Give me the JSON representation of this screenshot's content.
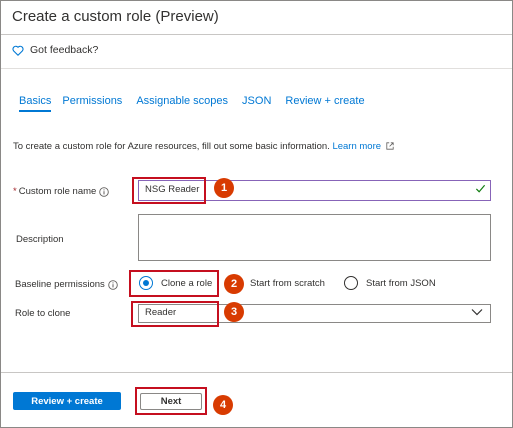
{
  "window": {
    "title": "Create a custom role (Preview)"
  },
  "feedback": {
    "label": "Got feedback?",
    "icon": "heart-icon"
  },
  "tabs": [
    {
      "label": "Basics",
      "active": true
    },
    {
      "label": "Permissions",
      "active": false
    },
    {
      "label": "Assignable scopes",
      "active": false
    },
    {
      "label": "JSON",
      "active": false
    },
    {
      "label": "Review + create",
      "active": false
    }
  ],
  "intro": {
    "text": "To create a custom role for Azure resources, fill out some basic information.",
    "link": "Learn more"
  },
  "form": {
    "required_marker": "*",
    "custom_role_name": {
      "label": "Custom role name",
      "value": "NSG Reader"
    },
    "description": {
      "label": "Description",
      "value": ""
    },
    "baseline_permissions": {
      "label": "Baseline permissions",
      "options": [
        {
          "label": "Clone a role",
          "selected": true
        },
        {
          "label": "Start from scratch",
          "selected": false
        },
        {
          "label": "Start from JSON",
          "selected": false
        }
      ]
    },
    "role_to_clone": {
      "label": "Role to clone",
      "value": "Reader"
    }
  },
  "footer": {
    "review_create_label": "Review + create",
    "next_label": "Next"
  },
  "callouts": [
    "1",
    "2",
    "3",
    "4"
  ],
  "colors": {
    "accent": "#0078d4",
    "highlight": "#c50f1f",
    "badge": "#d83b01",
    "valid_check": "#107c10"
  }
}
